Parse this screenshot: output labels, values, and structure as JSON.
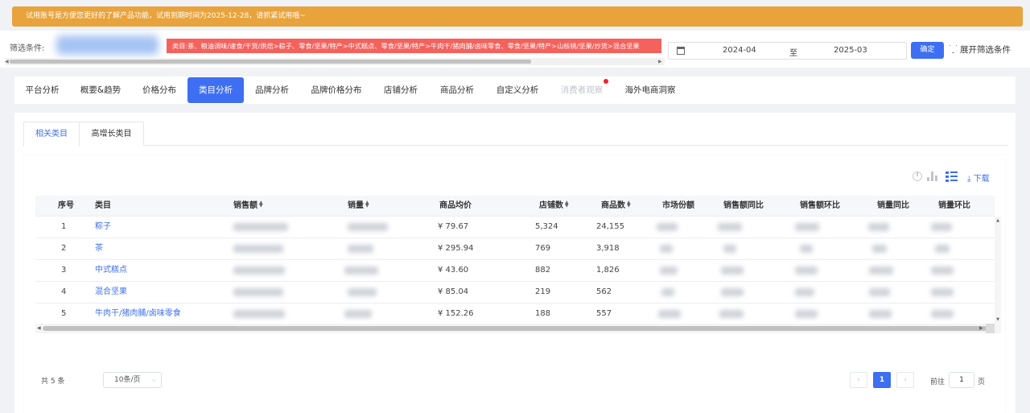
{
  "notice": "试用账号是方便您更好的了解产品功能，试用到期时间为2025-12-28，请抓紧试用哦~",
  "filter": {
    "label": "筛选条件:",
    "category_tag": "类目:茶、粮油调味/速食/干货/烘焙>粽子、零食/坚果/特产>中式糕点、零食/坚果/特产>牛肉干/猪肉脯/卤味零食、零食/坚果/特产>山核桃/坚果/炒货>混合坚果",
    "date_start": "2024-04",
    "date_sep": "至",
    "date_end": "2025-03",
    "confirm": "确定",
    "expand": "展开筛选条件"
  },
  "main_tabs": [
    {
      "label": "平台分析"
    },
    {
      "label": "概要&趋势"
    },
    {
      "label": "价格分布"
    },
    {
      "label": "类目分析",
      "active": true
    },
    {
      "label": "品牌分析"
    },
    {
      "label": "品牌价格分布"
    },
    {
      "label": "店铺分析"
    },
    {
      "label": "商品分析"
    },
    {
      "label": "自定义分析"
    },
    {
      "label": "消费者观察",
      "disabled": true
    },
    {
      "label": "海外电商洞察"
    }
  ],
  "sub_tabs": [
    {
      "label": "相关类目",
      "active": true
    },
    {
      "label": "高增长类目"
    }
  ],
  "toolbar": {
    "download": "下载",
    "icons": [
      "pie-chart-icon",
      "bar-chart-icon",
      "list-view-icon",
      "download-icon"
    ],
    "accent": "#3e6ff2"
  },
  "table": {
    "headers": {
      "index": "序号",
      "category": "类目",
      "sales_amount": "销售额",
      "sales_volume": "销量",
      "avg_price": "商品均价",
      "shop_count": "店铺数",
      "product_count": "商品数",
      "market_share": "市场份额",
      "sales_yoy": "销售额同比",
      "sales_mom": "销售额环比",
      "volume_yoy": "销量同比",
      "volume_mom": "销量环比"
    },
    "rows": [
      {
        "index": "1",
        "category": "粽子",
        "avg_price": "¥ 79.67",
        "shop_count": "5,324",
        "product_count": "24,155"
      },
      {
        "index": "2",
        "category": "茶",
        "avg_price": "¥ 295.94",
        "shop_count": "769",
        "product_count": "3,918"
      },
      {
        "index": "3",
        "category": "中式糕点",
        "avg_price": "¥ 43.60",
        "shop_count": "882",
        "product_count": "1,826"
      },
      {
        "index": "4",
        "category": "混合坚果",
        "avg_price": "¥ 85.04",
        "shop_count": "219",
        "product_count": "562"
      },
      {
        "index": "5",
        "category": "牛肉干/猪肉脯/卤味零食",
        "avg_price": "¥ 152.26",
        "shop_count": "188",
        "product_count": "557"
      }
    ]
  },
  "pagination": {
    "total": "共 5 条",
    "page_size": "10条/页",
    "current_page": "1",
    "goto_label": "前往",
    "goto_value": "1",
    "page_unit": "页"
  }
}
